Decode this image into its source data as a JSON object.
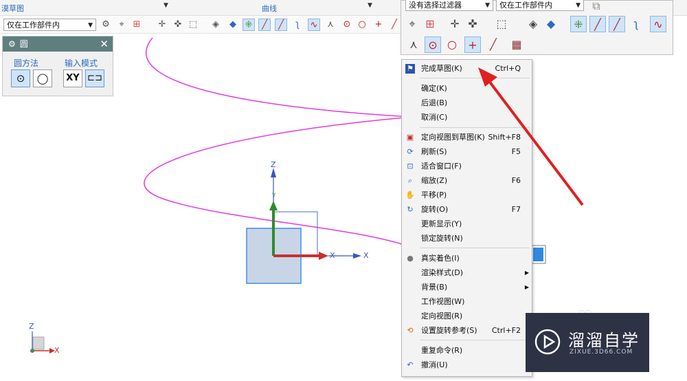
{
  "ribbon": {
    "left_label": "漠草图",
    "center_label": "曲线"
  },
  "toolbar": {
    "scope_combo": "仅在工作部件内"
  },
  "dialog": {
    "title": "圆",
    "group1": "圆方法",
    "group2": "输入模式",
    "xy_label": "XY"
  },
  "float_toolbar": {
    "filter_combo": "没有选择过滤器",
    "scope_combo": "仅在工作部件内"
  },
  "axes": {
    "z": "Z",
    "y": "Y",
    "x": "X",
    "mini_z": "Z",
    "mini_x": "X"
  },
  "menu": {
    "items": [
      {
        "label": "完成草图(K)",
        "shortcut": "Ctrl+Q",
        "icon": "finish-sketch-icon"
      },
      {
        "label": "确定(K)",
        "shortcut": ""
      },
      {
        "label": "后退(B)",
        "shortcut": ""
      },
      {
        "label": "取消(C)",
        "shortcut": ""
      },
      {
        "label": "定向视图到草图(K)",
        "shortcut": "Shift+F8",
        "icon": "orient-view-icon"
      },
      {
        "label": "刷新(S)",
        "shortcut": "F5",
        "icon": "refresh-icon"
      },
      {
        "label": "适合窗口(F)",
        "shortcut": "",
        "icon": "fit-window-icon"
      },
      {
        "label": "缩放(Z)",
        "shortcut": "F6",
        "icon": "zoom-icon"
      },
      {
        "label": "平移(P)",
        "shortcut": "",
        "icon": "pan-icon"
      },
      {
        "label": "旋转(O)",
        "shortcut": "F7",
        "icon": "rotate-icon"
      },
      {
        "label": "更新显示(Y)",
        "shortcut": ""
      },
      {
        "label": "锁定旋转(N)",
        "shortcut": ""
      },
      {
        "label": "真实着色(I)",
        "shortcut": "",
        "icon": "true-shading-icon"
      },
      {
        "label": "渲染样式(D)",
        "shortcut": "",
        "submenu": true
      },
      {
        "label": "背景(B)",
        "shortcut": "",
        "submenu": true
      },
      {
        "label": "工作视图(W)",
        "shortcut": ""
      },
      {
        "label": "定向视图(R)",
        "shortcut": ""
      },
      {
        "label": "设置旋转参考(S)",
        "shortcut": "Ctrl+F2",
        "icon": "rotate-reference-icon"
      },
      {
        "label": "重复命令(R)",
        "shortcut": "",
        "submenu": true
      },
      {
        "label": "撤消(U)",
        "shortcut": "",
        "icon": "undo-icon"
      }
    ]
  },
  "watermark": {
    "title": "溜溜自学",
    "subtitle": "ZIXUE.3D66.COM"
  },
  "colors": {
    "accent": "#2a6bbf",
    "helix": "#e23be0",
    "arrow": "#e02020",
    "dialog_title_bg": "#5f7f7f"
  }
}
